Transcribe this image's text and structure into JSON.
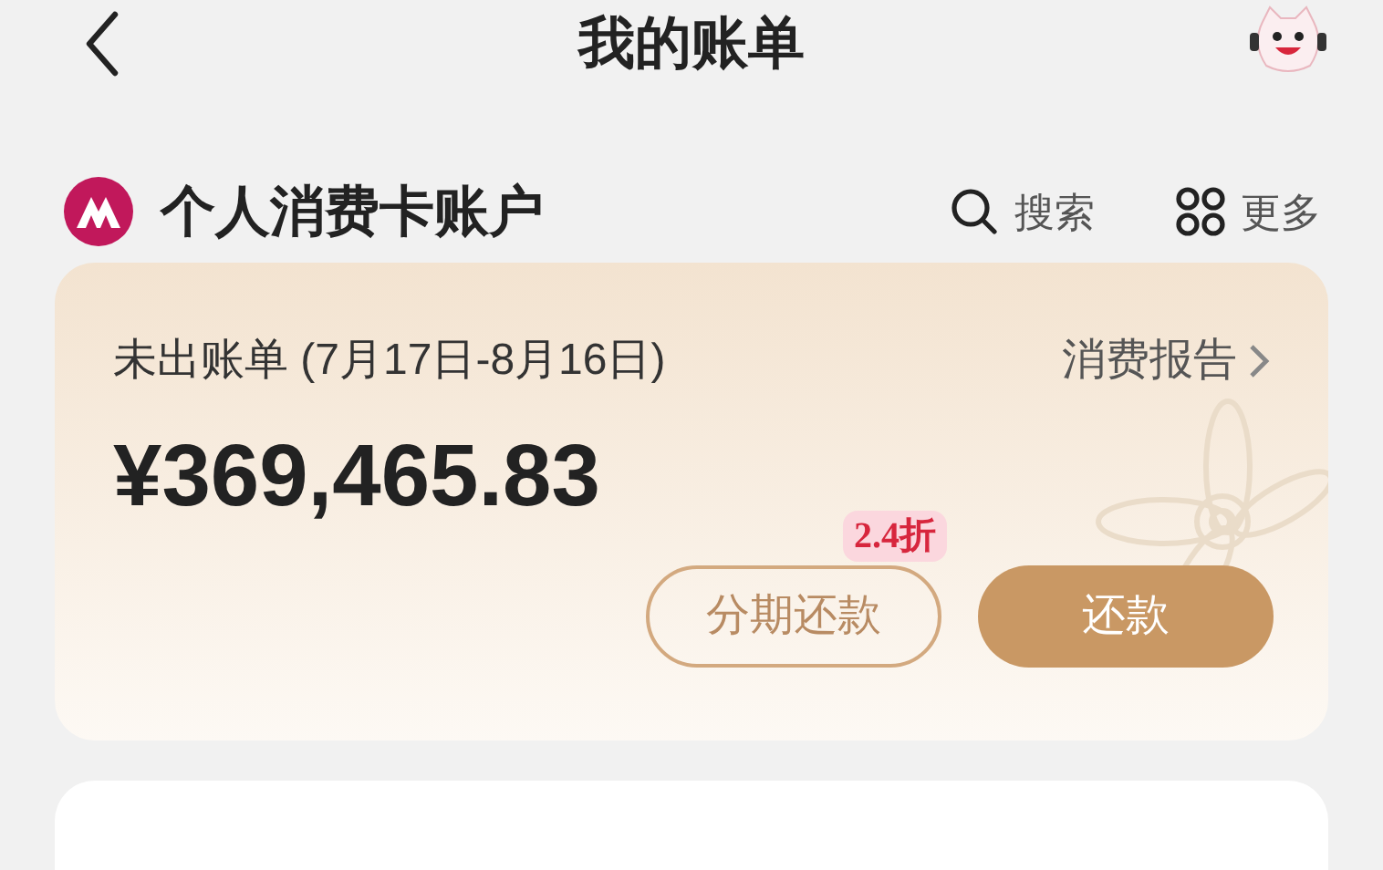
{
  "header": {
    "title": "我的账单"
  },
  "account": {
    "name": "个人消费卡账户",
    "actions": [
      {
        "kind": "search",
        "label": "搜索"
      },
      {
        "kind": "more",
        "label": "更多"
      }
    ]
  },
  "bill": {
    "period_label": "未出账单 (7月17日-8月16日)",
    "report_link": "消费报告",
    "amount": "¥369,465.83",
    "installment_button": "分期还款",
    "discount_badge": "2.4折",
    "repay_button": "还款"
  }
}
